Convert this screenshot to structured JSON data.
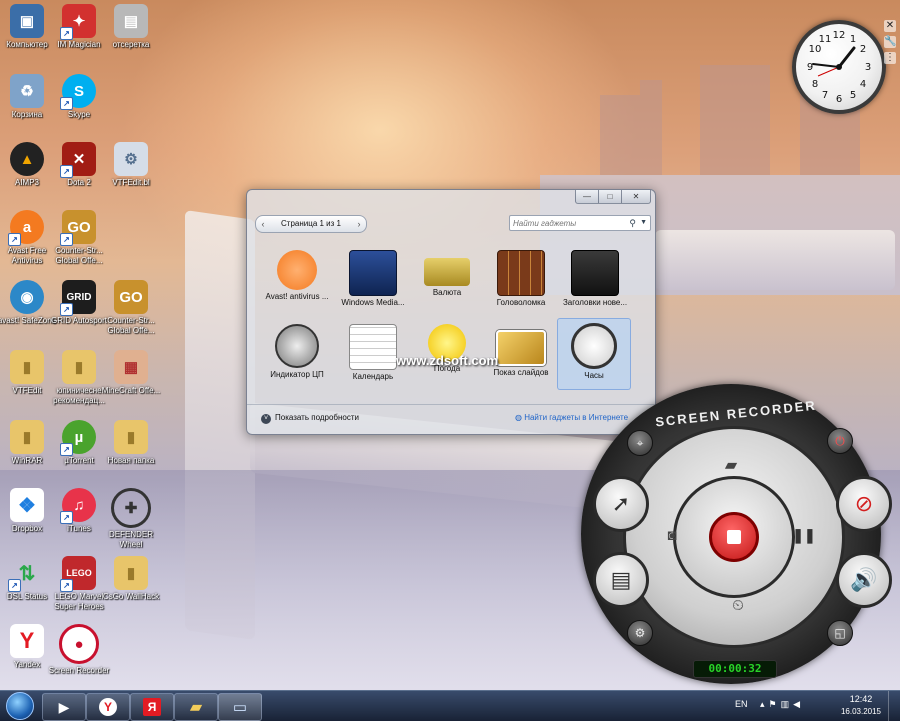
{
  "desktop_icons": [
    {
      "label": "Компьютер",
      "icon": "computer-icon",
      "color": "#3b6ea8"
    },
    {
      "label": "IM Magician",
      "icon": "im-magician-icon",
      "color": "#d2312f"
    },
    {
      "label": "отсеретка",
      "icon": "folder-icon",
      "color": "#b8b8b8"
    },
    {
      "label": "Корзина",
      "icon": "recycle-bin-icon",
      "color": "#7fa3c9"
    },
    {
      "label": "Skype",
      "icon": "skype-icon",
      "color": "#00aff0"
    },
    {
      "label": "AIMP3",
      "icon": "aimp-icon",
      "color": "#f0a500"
    },
    {
      "label": "Dota 2",
      "icon": "dota2-icon",
      "color": "#a11d14"
    },
    {
      "label": "VTFEdit.bl",
      "icon": "file-icon",
      "color": "#d5dde8"
    },
    {
      "label": "Avast Free Antivirus",
      "icon": "avast-icon",
      "color": "#f47a20"
    },
    {
      "label": "Counter-Str... Global Offe...",
      "icon": "csgo-icon",
      "color": "#c8912d"
    },
    {
      "label": "avast! SafeZone",
      "icon": "safezone-icon",
      "color": "#2c88c8"
    },
    {
      "label": "GRID Autosport",
      "icon": "grid-icon",
      "color": "#1d1d1d"
    },
    {
      "label": "Counter-Str... Global Offe...",
      "icon": "csgo-icon",
      "color": "#c8912d"
    },
    {
      "label": "VTFEdit",
      "icon": "folder-icon",
      "color": "#e8c56a"
    },
    {
      "label": "юпиничесне рекомендац...",
      "icon": "folder-icon",
      "color": "#e8c56a"
    },
    {
      "label": "MineCraft Offe...",
      "icon": "minecraft-cake-icon",
      "color": "#e0b090"
    },
    {
      "label": "WinRAR",
      "icon": "folder-icon",
      "color": "#e8c56a"
    },
    {
      "label": "µTorrent",
      "icon": "utorrent-icon",
      "color": "#4aa32d"
    },
    {
      "label": "Новая папка",
      "icon": "folder-icon",
      "color": "#e8c56a"
    },
    {
      "label": "Dropbox",
      "icon": "dropbox-icon",
      "color": "#1f7fe0"
    },
    {
      "label": "iTunes",
      "icon": "itunes-icon",
      "color": "#e8334a"
    },
    {
      "label": "DEFENDER Wheel",
      "icon": "wheel-icon",
      "color": "#444"
    },
    {
      "label": "DSL Status",
      "icon": "dsl-status-icon",
      "color": "#2aa84a"
    },
    {
      "label": "LEGO Marvel Super Heroes",
      "icon": "lego-marvel-icon",
      "color": "#c0282c"
    },
    {
      "label": "CsGo WallHack",
      "icon": "folder-icon",
      "color": "#e8c56a"
    },
    {
      "label": "Yandex",
      "icon": "yandex-icon",
      "color": "#e31b23"
    },
    {
      "label": "Screen Recorder",
      "icon": "screen-recorder-icon",
      "color": "#c8102e"
    }
  ],
  "gallery": {
    "pager": "Страница 1 из 1",
    "search_placeholder": "Найти гаджеты",
    "items": [
      {
        "label": "Avast! antivirus ...",
        "icon": "avast-gadget-icon"
      },
      {
        "label": "Windows Media...",
        "icon": "media-center-gadget-icon"
      },
      {
        "label": "Валюта",
        "icon": "currency-gadget-icon"
      },
      {
        "label": "Головоломка",
        "icon": "puzzle-gadget-icon"
      },
      {
        "label": "Заголовки нове...",
        "icon": "headlines-gadget-icon"
      },
      {
        "label": "Индикатор ЦП",
        "icon": "cpu-meter-gadget-icon"
      },
      {
        "label": "Календарь",
        "icon": "calendar-gadget-icon"
      },
      {
        "label": "Погода",
        "icon": "weather-gadget-icon"
      },
      {
        "label": "Показ слайдов",
        "icon": "slideshow-gadget-icon"
      },
      {
        "label": "Часы",
        "icon": "clock-gadget-icon"
      }
    ],
    "details_label": "Показать подробности",
    "online_link": "Найти гаджеты в Интернете"
  },
  "watermark": "www.zdsoft.com",
  "recorder": {
    "title": "SCREEN RECORDER",
    "timer": "00:00:32",
    "accent": "#d31f1f"
  },
  "taskbar": {
    "lang": "EN",
    "time": "12:42",
    "date": "16.03.2015"
  }
}
